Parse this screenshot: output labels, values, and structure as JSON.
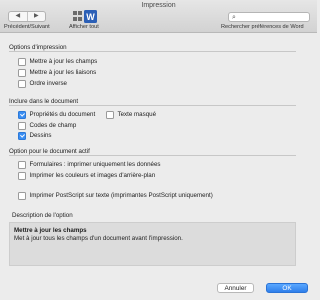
{
  "window": {
    "title": "Impression"
  },
  "toolbar": {
    "nav_label": "Précédent/Suivant",
    "prev_glyph": "◀",
    "next_glyph": "▶",
    "show_all_label": "Afficher tout",
    "search_placeholder": "",
    "search_label": "Rechercher préférences de Word",
    "word_icon_letter": "W"
  },
  "sections": {
    "options_impression": {
      "title": "Options d'impression",
      "items": [
        {
          "label": "Mettre à jour les champs",
          "checked": false
        },
        {
          "label": "Mettre à jour les liaisons",
          "checked": false
        },
        {
          "label": "Ordre inverse",
          "checked": false
        }
      ]
    },
    "inclure": {
      "title": "Inclure dans le document",
      "items": [
        {
          "label": "Propriétés du document",
          "checked": true
        },
        {
          "label": "Codes de champ",
          "checked": false
        },
        {
          "label": "Dessins",
          "checked": true
        },
        {
          "label": "Texte masqué",
          "checked": false
        }
      ]
    },
    "document_actif": {
      "title": "Option pour le document actif",
      "items": [
        {
          "label": "Formulaires : imprimer uniquement les données",
          "checked": false
        },
        {
          "label": "Imprimer les couleurs et images d'arrière-plan",
          "checked": false
        },
        {
          "label": "Imprimer PostScript sur texte (imprimantes PostScript uniquement)",
          "checked": false
        }
      ]
    }
  },
  "description": {
    "title": "Description de l'option",
    "heading": "Mettre à jour les champs",
    "text": "Met à jour tous les champs d'un document avant l'impression."
  },
  "buttons": {
    "cancel": "Annuler",
    "ok": "OK"
  },
  "colors": {
    "accent": "#3a8ef3",
    "window_bg": "#ececec",
    "desc_bg": "#dcdcdc"
  }
}
